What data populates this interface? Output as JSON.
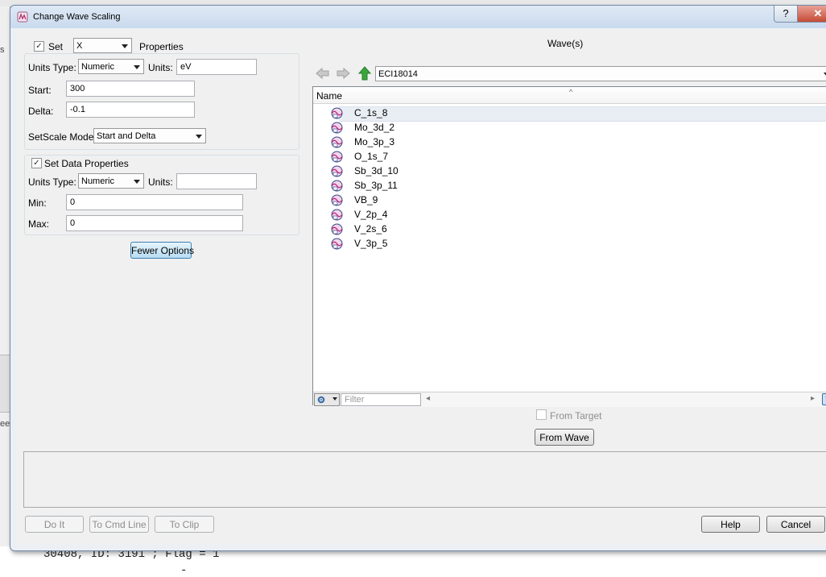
{
  "background": {
    "console_line": "30408, ID: 3191 ; Flag = 1",
    "console_dash": "-",
    "left_fragments": [
      "s",
      "ee"
    ]
  },
  "window": {
    "title": "Change Wave Scaling",
    "help_glyph": "?",
    "close_glyph": "✕"
  },
  "set_dim": {
    "checkbox_label": "Set",
    "dimension": "X",
    "suffix": "Properties",
    "checked": true
  },
  "dim_props": {
    "units_type_label": "Units Type:",
    "units_type": "Numeric",
    "units_label": "Units:",
    "units": "eV",
    "start_label": "Start:",
    "start": "300",
    "delta_label": "Delta:",
    "delta": "-0.1",
    "mode_label": "SetScale Mode:",
    "mode": "Start and Delta"
  },
  "data_props": {
    "checkbox_label": "Set Data Properties",
    "checked": true,
    "units_type_label": "Units Type:",
    "units_type": "Numeric",
    "units_label": "Units:",
    "units": "",
    "min_label": "Min:",
    "min": "0",
    "max_label": "Max:",
    "max": "0"
  },
  "fewer_options": "Fewer Options",
  "waves_panel": {
    "heading": "Wave(s)",
    "folder": "ECI18014",
    "column_name": "Name",
    "items": [
      "C_1s_8",
      "Mo_3d_2",
      "Mo_3p_3",
      "O_1s_7",
      "Sb_3d_10",
      "Sb_3p_11",
      "VB_9",
      "V_2p_4",
      "V_2s_6",
      "V_3p_5"
    ],
    "filter_placeholder": "Filter",
    "help_glyph": "?",
    "from_target_label": "From Target",
    "from_wave_label": "From Wave"
  },
  "footer": {
    "do_it": "Do It",
    "to_cmd_line": "To Cmd Line",
    "to_clip": "To Clip",
    "help": "Help",
    "cancel": "Cancel"
  },
  "colors": {
    "titlebar_top": "#dfe9f5",
    "close_button": "#c44b35",
    "nav_up_green": "#3aa63a",
    "focused_button": "#3c7fb1"
  },
  "icons": {
    "nav_back": "left-arrow-icon",
    "nav_forward": "right-arrow-icon",
    "nav_up": "green-up-arrow-icon",
    "wave": "wave-globe-icon",
    "settings": "gear-icon"
  }
}
